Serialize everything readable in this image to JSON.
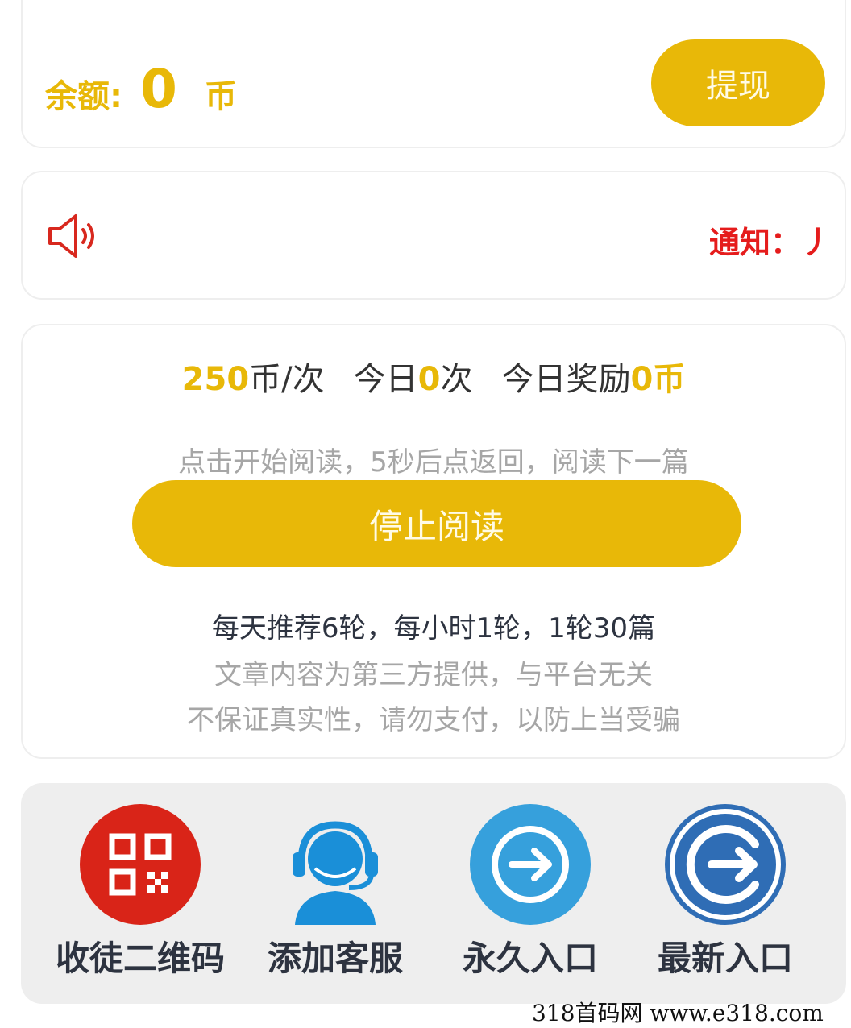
{
  "balance": {
    "label": "余额:",
    "amount": "0",
    "unit": "币",
    "withdraw_label": "提现"
  },
  "notice": {
    "text": "通知：丿"
  },
  "read": {
    "reward_value": "250",
    "reward_unit": "币/次",
    "today_prefix": "今日",
    "today_count": "0",
    "today_suffix": "次",
    "bonus_prefix": "今日奖励",
    "bonus_value": "0",
    "bonus_unit": "币",
    "hint": "点击开始阅读，5秒后点返回，阅读下一篇",
    "stop_label": "停止阅读",
    "info_lines": [
      "每天推荐6轮，每小时1轮，1轮30篇",
      "文章内容为第三方提供，与平台无关",
      "不保证真实性，请勿支付，以防上当受骗"
    ]
  },
  "entries": [
    {
      "label": "收徒二维码",
      "icon": "qr-code-icon",
      "color": "#d92418"
    },
    {
      "label": "添加客服",
      "icon": "customer-service-icon",
      "color": "#1a8fd8"
    },
    {
      "label": "永久入口",
      "icon": "arrow-right-circle-icon",
      "color": "#36a0dc"
    },
    {
      "label": "最新入口",
      "icon": "exit-arrow-icon",
      "color": "#2f6db5"
    }
  ],
  "colors": {
    "accent": "#e8b808",
    "notice": "#e51c1c",
    "text_dark": "#2d3340",
    "text_muted": "#a6a6a6"
  },
  "watermark": "318首码网  www.e318.com"
}
